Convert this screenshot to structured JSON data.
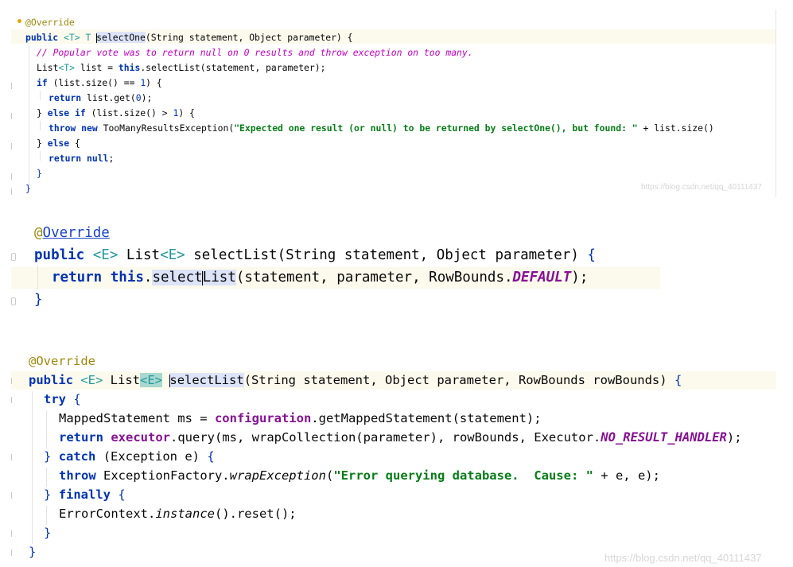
{
  "panel1": {
    "lines": [
      "@Override",
      "public <T> T selectOne(String statement, Object parameter) {",
      "// Popular vote was to return null on 0 results and throw exception on too many.",
      "List<T> list = this.selectList(statement, parameter);",
      "if (list.size() == 1) {",
      "return list.get(0);",
      "} else if (list.size() > 1) {",
      "throw new TooManyResultsException(\"Expected one result (or null) to be returned by selectOne(), but found: \" + list.size());",
      "} else {",
      "return null;",
      "}",
      "}"
    ],
    "watermark": "https://blog.csdn.net/qq_40111437"
  },
  "panel2": {
    "lines": [
      "@Override",
      "public <E> List<E> selectList(String statement, Object parameter) {",
      "return this.selectList(statement, parameter, RowBounds.DEFAULT);",
      "}"
    ]
  },
  "panel3": {
    "lines": [
      "@Override",
      "public <E> List<E> selectList(String statement, Object parameter, RowBounds rowBounds) {",
      "try {",
      "MappedStatement ms = configuration.getMappedStatement(statement);",
      "return executor.query(ms, wrapCollection(parameter), rowBounds, Executor.NO_RESULT_HANDLER);",
      "} catch (Exception e) {",
      "throw ExceptionFactory.wrapException(\"Error querying database.  Cause: \" + e, e);",
      "} finally {",
      "ErrorContext.instance().reset();",
      "}",
      "}"
    ],
    "watermark": "https://blog.csdn.net/qq_40111437"
  },
  "colors": {
    "keyword": "#0033b3",
    "annotation": "#9e880d",
    "type_param": "#20999d",
    "string": "#067d17",
    "comment": "#c300c3",
    "field": "#871094",
    "current_line": "#fcfaed",
    "selection": "#dde4f9"
  }
}
